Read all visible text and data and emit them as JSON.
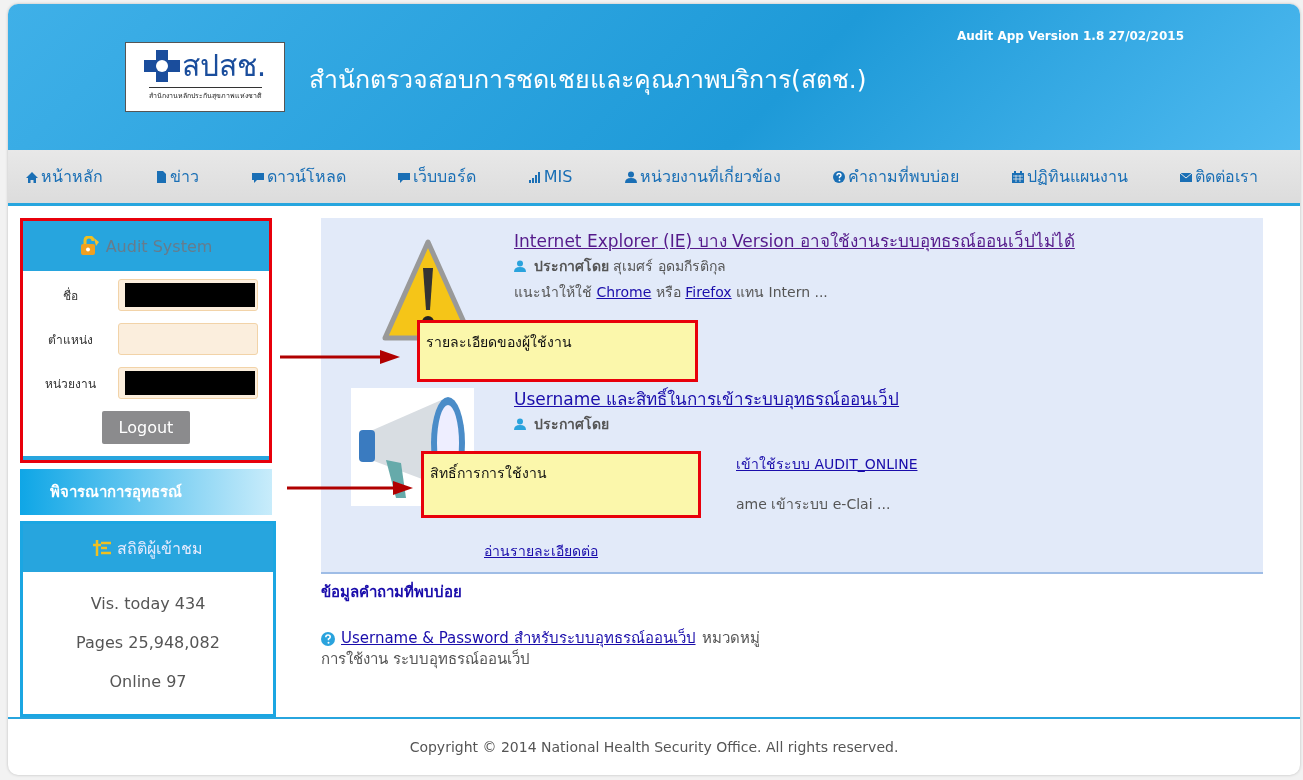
{
  "header": {
    "logo_text": "สปสช.",
    "logo_subtitle": "สำนักงานหลักประกันสุขภาพแห่งชาติ",
    "title": "สำนักตรวจสอบการชดเชยและคุณภาพบริการ(สตช.)",
    "version": "Audit App Version 1.8 27/02/2015"
  },
  "nav": [
    {
      "label": "หน้าหลัก"
    },
    {
      "label": "ข่าว"
    },
    {
      "label": "ดาวน์โหลด"
    },
    {
      "label": "เว็บบอร์ด"
    },
    {
      "label": "MIS"
    },
    {
      "label": "หน่วยงานที่เกี่ยวข้อง"
    },
    {
      "label": "คำถามที่พบบ่อย"
    },
    {
      "label": "ปฏิทินแผนงาน"
    },
    {
      "label": "ติดต่อเรา"
    }
  ],
  "login_panel": {
    "title": "Audit System",
    "fields": [
      {
        "label": "ชื่อ",
        "redacted": true
      },
      {
        "label": "ตำแหน่ง",
        "redacted": false
      },
      {
        "label": "หน่วยงาน",
        "redacted": true
      }
    ],
    "button": "Logout"
  },
  "menu_item": "พิจารณาการอุทธรณ์",
  "stats_panel": {
    "title": "สถิติผู้เข้าชม",
    "lines": [
      "Vis. today 434",
      "Pages 25,948,082",
      "Online 97"
    ]
  },
  "news": [
    {
      "kind": "warning",
      "title": "Internet Explorer (IE) บาง Version อาจใช้งานระบบอุทธรณ์ออนเว็ปไม่ได้",
      "posted_by": "ประกาศโดย",
      "author": "สุเมศร์ อุดมกีรติกุล",
      "lines": [
        {
          "covered_start": false,
          "parts": [
            {
              "kind": "text",
              "text": "แนะนำให้ใช้ "
            },
            {
              "kind": "link",
              "text": "Chrome"
            },
            {
              "kind": "text",
              "text": " หรือ "
            },
            {
              "kind": "link",
              "text": "Firefox"
            },
            {
              "kind": "text",
              "text": " แทน Intern ..."
            }
          ]
        }
      ]
    },
    {
      "kind": "megaphone",
      "title": "Username และสิทธิ์ในการเข้าระบบอุทธรณ์ออนเว็ป",
      "posted_by": "ประกาศโดย",
      "lines": [
        {
          "covered_start": true,
          "parts": [
            {
              "kind": "link",
              "text": "เข้าใช้ระบบ AUDIT_ONLINE"
            }
          ]
        },
        {
          "covered_start": true,
          "parts": [
            {
              "kind": "text",
              "text": "ame เข้าระบบ e-Clai ..."
            }
          ]
        }
      ]
    }
  ],
  "read_more": "อ่านรายละเอียดต่อ",
  "faq": {
    "heading": "ข้อมูลคำถามที่พบบ่อย",
    "items": [
      {
        "question": "Username & Password สำหรับระบบอุทธรณ์ออนเว็ป",
        "category_label": "หมวดหมู่",
        "category": "การใช้งาน ระบบอุทธรณ์ออนเว็ป"
      }
    ]
  },
  "footer": "Copyright © 2014 National Health Security Office. All rights reserved.",
  "callouts": [
    {
      "text": "รายละเอียดของผู้ใช้งาน"
    },
    {
      "text": "สิทธิ์การการใช้งาน"
    }
  ]
}
